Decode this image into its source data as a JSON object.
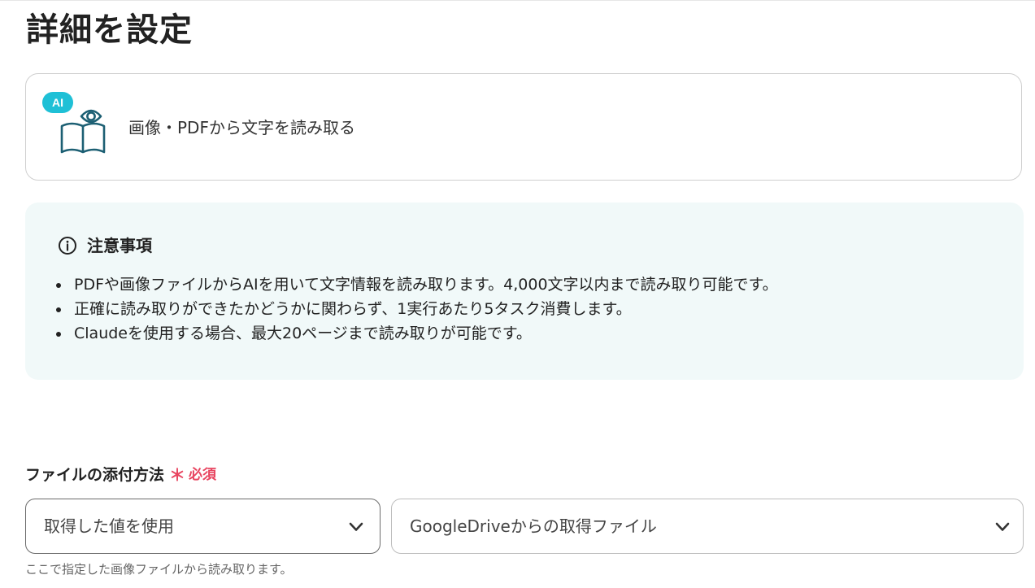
{
  "page": {
    "title": "詳細を設定"
  },
  "action": {
    "badge": "AI",
    "icon": "book-eye-icon",
    "label": "画像・PDFから文字を読み取る"
  },
  "notice": {
    "icon": "info-icon",
    "title": "注意事項",
    "items": [
      "PDFや画像ファイルからAIを用いて文字情報を読み取ります。4,000文字以内まで読み取り可能です。",
      "正確に読み取りができたかどうかに関わらず、1実行あたり5タスク消費します。",
      "Claudeを使用する場合、最大20ページまで読み取りが可能です。"
    ]
  },
  "field": {
    "label": "ファイルの添付方法",
    "required_mark": "＊",
    "required_text": "必須",
    "method_select": {
      "value": "取得した値を使用",
      "icon": "chevron-down-icon"
    },
    "source_select": {
      "value": "GoogleDriveからの取得ファイル",
      "icon": "chevron-down-icon"
    },
    "help": "ここで指定した画像ファイルから読み取ります。"
  },
  "colors": {
    "accent": "#1fc0d6",
    "icon_stroke": "#1c5f73",
    "required": "#e84560",
    "notice_bg": "#f1f9f9"
  }
}
